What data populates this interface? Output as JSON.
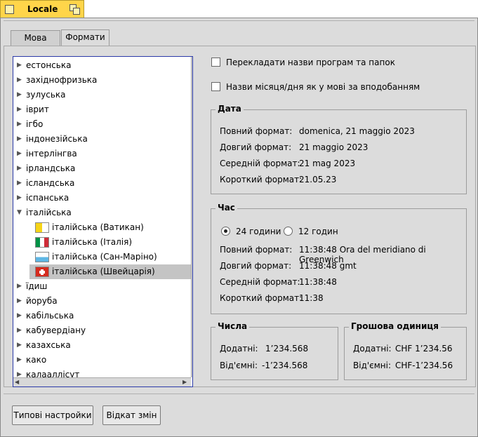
{
  "window": {
    "title": "Locale"
  },
  "tabs": [
    {
      "label": "Мова"
    },
    {
      "label": "Формати"
    }
  ],
  "languages": [
    {
      "label": "естонська"
    },
    {
      "label": "західнофризька"
    },
    {
      "label": "зулуська"
    },
    {
      "label": "іврит"
    },
    {
      "label": "ігбо"
    },
    {
      "label": "індонезійська"
    },
    {
      "label": "інтерлінгва"
    },
    {
      "label": "ірландська"
    },
    {
      "label": "ісландська"
    },
    {
      "label": "іспанська"
    },
    {
      "label": "італійська"
    },
    {
      "label": "італійська (Ватикан)",
      "flag": "vatican-flag"
    },
    {
      "label": "італійська (Італія)",
      "flag": "italy-flag"
    },
    {
      "label": "італійська (Сан-Маріно)",
      "flag": "san-marino-flag"
    },
    {
      "label": "італійська (Швейцарія)",
      "flag": "switzerland-flag"
    },
    {
      "label": "їдиш"
    },
    {
      "label": "йоруба"
    },
    {
      "label": "кабільська"
    },
    {
      "label": "кабувердіану"
    },
    {
      "label": "казахська"
    },
    {
      "label": "како"
    },
    {
      "label": "калааллісут"
    }
  ],
  "options": {
    "translate_names": "Перекладати назви програм та папок",
    "month_day_names": "Назви місяця/дня як у мові за вподобанням"
  },
  "date": {
    "title": "Дата",
    "rows": [
      {
        "label": "Повний формат:",
        "value": "domenica, 21 maggio 2023"
      },
      {
        "label": "Довгий формат:",
        "value": "21 maggio 2023"
      },
      {
        "label": "Середній формат:",
        "value": "21 mag 2023"
      },
      {
        "label": "Короткий формат:",
        "value": "21.05.23"
      }
    ]
  },
  "time": {
    "title": "Час",
    "radio24": "24 години",
    "radio12": "12 годин",
    "rows": [
      {
        "label": "Повний формат:",
        "value": "11:38:48 Ora del meridiano di Greenwich"
      },
      {
        "label": "Довгий формат:",
        "value": "11:38:48 gmt"
      },
      {
        "label": "Середній формат:",
        "value": "11:38:48"
      },
      {
        "label": "Короткий формат:",
        "value": "11:38"
      }
    ]
  },
  "numbers": {
    "title": "Числа",
    "positive_label": "Додатні:",
    "positive_value": "1’234.568",
    "negative_label": "Від'ємні:",
    "negative_value": "-1’234.568"
  },
  "currency": {
    "title": "Грошова одиниця",
    "positive_label": "Додатні:",
    "positive_value": "CHF 1’234.56",
    "negative_label": "Від'ємні:",
    "negative_value": "CHF-1’234.56"
  },
  "buttons": {
    "defaults": "Типові настройки",
    "revert": "Відкат змін"
  }
}
